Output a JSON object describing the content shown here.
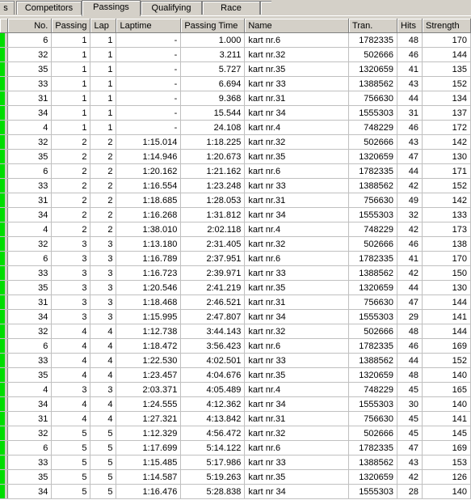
{
  "tabs": [
    {
      "label": "s",
      "active": false
    },
    {
      "label": "Competitors",
      "active": false
    },
    {
      "label": "Passings",
      "active": true
    },
    {
      "label": "Qualifying",
      "active": false
    },
    {
      "label": "Race",
      "active": false
    },
    {
      "label": "",
      "active": false
    }
  ],
  "colors": {
    "indicator": "#00dd00",
    "header_bg": "#d4d0c8"
  },
  "columns": [
    "No.",
    "Passing",
    "Lap",
    "Laptime",
    "Passing Time",
    "Name",
    "Tran.",
    "Hits",
    "Strength"
  ],
  "rows": [
    [
      "6",
      "1",
      "1",
      "-",
      "1.000",
      "kart nr.6",
      "1782335",
      "48",
      "170"
    ],
    [
      "32",
      "1",
      "1",
      "-",
      "3.211",
      "kart nr.32",
      "502666",
      "46",
      "144"
    ],
    [
      "35",
      "1",
      "1",
      "-",
      "5.727",
      "kart nr.35",
      "1320659",
      "41",
      "135"
    ],
    [
      "33",
      "1",
      "1",
      "-",
      "6.694",
      "kart nr 33",
      "1388562",
      "43",
      "152"
    ],
    [
      "31",
      "1",
      "1",
      "-",
      "9.368",
      "kart nr.31",
      "756630",
      "44",
      "134"
    ],
    [
      "34",
      "1",
      "1",
      "-",
      "15.544",
      "kart nr 34",
      "1555303",
      "31",
      "137"
    ],
    [
      "4",
      "1",
      "1",
      "-",
      "24.108",
      "kart nr.4",
      "748229",
      "46",
      "172"
    ],
    [
      "32",
      "2",
      "2",
      "1:15.014",
      "1:18.225",
      "kart nr.32",
      "502666",
      "43",
      "142"
    ],
    [
      "35",
      "2",
      "2",
      "1:14.946",
      "1:20.673",
      "kart nr.35",
      "1320659",
      "47",
      "130"
    ],
    [
      "6",
      "2",
      "2",
      "1:20.162",
      "1:21.162",
      "kart nr.6",
      "1782335",
      "44",
      "171"
    ],
    [
      "33",
      "2",
      "2",
      "1:16.554",
      "1:23.248",
      "kart nr 33",
      "1388562",
      "42",
      "152"
    ],
    [
      "31",
      "2",
      "2",
      "1:18.685",
      "1:28.053",
      "kart nr.31",
      "756630",
      "49",
      "142"
    ],
    [
      "34",
      "2",
      "2",
      "1:16.268",
      "1:31.812",
      "kart nr 34",
      "1555303",
      "32",
      "133"
    ],
    [
      "4",
      "2",
      "2",
      "1:38.010",
      "2:02.118",
      "kart nr.4",
      "748229",
      "42",
      "173"
    ],
    [
      "32",
      "3",
      "3",
      "1:13.180",
      "2:31.405",
      "kart nr.32",
      "502666",
      "46",
      "138"
    ],
    [
      "6",
      "3",
      "3",
      "1:16.789",
      "2:37.951",
      "kart nr.6",
      "1782335",
      "41",
      "170"
    ],
    [
      "33",
      "3",
      "3",
      "1:16.723",
      "2:39.971",
      "kart nr 33",
      "1388562",
      "42",
      "150"
    ],
    [
      "35",
      "3",
      "3",
      "1:20.546",
      "2:41.219",
      "kart nr.35",
      "1320659",
      "44",
      "130"
    ],
    [
      "31",
      "3",
      "3",
      "1:18.468",
      "2:46.521",
      "kart nr.31",
      "756630",
      "47",
      "144"
    ],
    [
      "34",
      "3",
      "3",
      "1:15.995",
      "2:47.807",
      "kart nr 34",
      "1555303",
      "29",
      "141"
    ],
    [
      "32",
      "4",
      "4",
      "1:12.738",
      "3:44.143",
      "kart nr.32",
      "502666",
      "48",
      "144"
    ],
    [
      "6",
      "4",
      "4",
      "1:18.472",
      "3:56.423",
      "kart nr.6",
      "1782335",
      "46",
      "169"
    ],
    [
      "33",
      "4",
      "4",
      "1:22.530",
      "4:02.501",
      "kart nr 33",
      "1388562",
      "44",
      "152"
    ],
    [
      "35",
      "4",
      "4",
      "1:23.457",
      "4:04.676",
      "kart nr.35",
      "1320659",
      "48",
      "140"
    ],
    [
      "4",
      "3",
      "3",
      "2:03.371",
      "4:05.489",
      "kart nr.4",
      "748229",
      "45",
      "165"
    ],
    [
      "34",
      "4",
      "4",
      "1:24.555",
      "4:12.362",
      "kart nr 34",
      "1555303",
      "30",
      "140"
    ],
    [
      "31",
      "4",
      "4",
      "1:27.321",
      "4:13.842",
      "kart nr.31",
      "756630",
      "45",
      "141"
    ],
    [
      "32",
      "5",
      "5",
      "1:12.329",
      "4:56.472",
      "kart nr.32",
      "502666",
      "45",
      "145"
    ],
    [
      "6",
      "5",
      "5",
      "1:17.699",
      "5:14.122",
      "kart nr.6",
      "1782335",
      "47",
      "169"
    ],
    [
      "33",
      "5",
      "5",
      "1:15.485",
      "5:17.986",
      "kart nr 33",
      "1388562",
      "43",
      "153"
    ],
    [
      "35",
      "5",
      "5",
      "1:14.587",
      "5:19.263",
      "kart nr.35",
      "1320659",
      "42",
      "126"
    ],
    [
      "34",
      "5",
      "5",
      "1:16.476",
      "5:28.838",
      "kart nr 34",
      "1555303",
      "28",
      "140"
    ]
  ]
}
